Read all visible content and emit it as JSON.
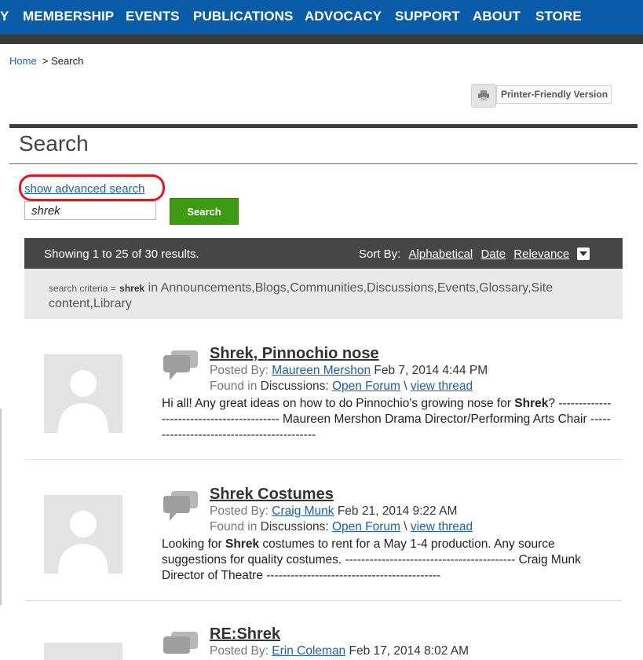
{
  "nav": {
    "items": [
      "Y",
      "MEMBERSHIP",
      "EVENTS",
      "PUBLICATIONS",
      "ADVOCACY",
      "SUPPORT",
      "ABOUT",
      "STORE"
    ]
  },
  "breadcrumb": {
    "home": "Home",
    "separator": ">",
    "current": "Search"
  },
  "printer": {
    "label": "Printer-Friendly Version"
  },
  "page": {
    "title": "Search"
  },
  "search": {
    "advanced_link": "show advanced search",
    "query": "shrek",
    "button_label": "Search"
  },
  "results_bar": {
    "count_text": "Showing 1 to 25 of 30 results.",
    "sort_label": "Sort By:",
    "sort_options": [
      "Alphabetical",
      "Date",
      "Relevance"
    ]
  },
  "criteria": {
    "prefix": "search criteria =",
    "term": "shrek",
    "scope": "in Announcements,Blogs,Communities,Discussions,Events,Glossary,Site content,Library"
  },
  "results": [
    {
      "title": "Shrek, Pinnochio nose",
      "posted_label": "Posted By:",
      "author": "Maureen Mershon",
      "date": "Feb 7, 2014 4:44 PM",
      "found_label": "Found in",
      "section": "Discussions:",
      "forum": "Open Forum",
      "sep": "\\",
      "thread": "view thread",
      "excerpt_before": "Hi all! Any great ideas on how to do Pinnochio's growing nose for",
      "excerpt_bold": "Shrek",
      "excerpt_after": "? ------------------------------------------ Maureen Mershon Drama Director/Performing Arts Chair -------------------------------------------"
    },
    {
      "title": "Shrek Costumes",
      "posted_label": "Posted By:",
      "author": "Craig Munk",
      "date": "Feb 21, 2014 9:22 AM",
      "found_label": "Found in",
      "section": "Discussions:",
      "forum": "Open Forum",
      "sep": "\\",
      "thread": "view thread",
      "excerpt_before": "Looking for",
      "excerpt_bold": "Shrek",
      "excerpt_after": "costumes to rent for a May 1-4 production. Any source suggestions for quality costumes. ------------------------------------------ Craig Munk Director of Theatre -------------------------------------------"
    },
    {
      "title": "RE:Shrek",
      "posted_label": "Posted By:",
      "author": "Erin Coleman",
      "date": "Feb 17, 2014 8:02 AM"
    }
  ],
  "colors": {
    "nav_blue": "#0a5ca8",
    "nav_dark": "#3a3a3a",
    "link_blue": "#1f5ea8",
    "search_green": "#3d9a12",
    "highlight_red": "#e0171f",
    "results_bar": "#464646",
    "criteria_bg": "#e9e9e9"
  },
  "icons": {
    "printer": "printer-icon",
    "discussion": "speech-bubbles-icon",
    "avatar": "default-avatar-icon",
    "sort_caret": "chevron-down-icon"
  }
}
